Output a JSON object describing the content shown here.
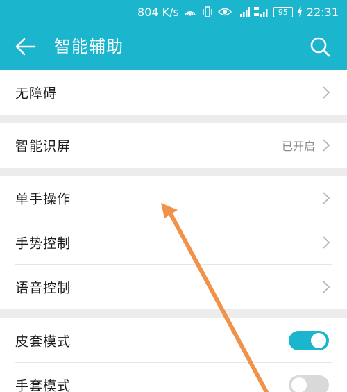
{
  "status_bar": {
    "speed": "804 K/s",
    "battery": "95",
    "time": "22:31"
  },
  "header": {
    "title": "智能辅助"
  },
  "sections": [
    {
      "items": [
        {
          "label": "无障碍",
          "value": ""
        }
      ]
    },
    {
      "items": [
        {
          "label": "智能识屏",
          "value": "已开启"
        }
      ]
    },
    {
      "items": [
        {
          "label": "单手操作",
          "value": ""
        },
        {
          "label": "手势控制",
          "value": ""
        },
        {
          "label": "语音控制",
          "value": ""
        }
      ]
    },
    {
      "items": [
        {
          "label": "皮套模式",
          "toggle": true
        },
        {
          "label": "手套模式",
          "toggle": false
        }
      ]
    }
  ],
  "colors": {
    "accent": "#1bb5cd",
    "annotation_arrow": "#f0924a"
  }
}
